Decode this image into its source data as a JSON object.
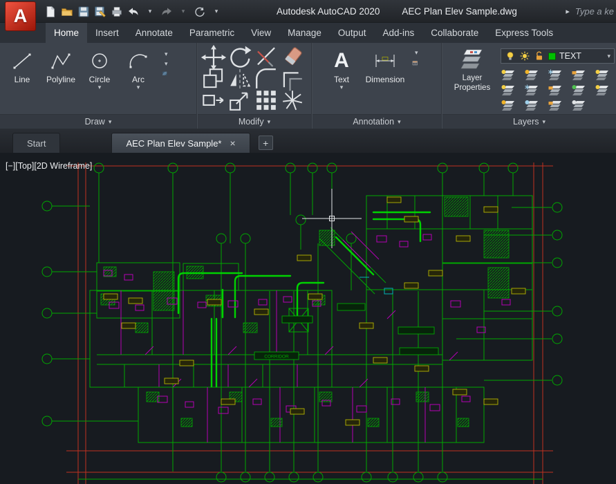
{
  "titlebar": {
    "logo_letter": "A",
    "app_title": "Autodesk AutoCAD 2020",
    "doc_title": "AEC Plan Elev Sample.dwg",
    "search_text": "Type a ke"
  },
  "icons": {
    "dropdown": "▾",
    "right_arrow": "▸",
    "plus": "+",
    "close": "×"
  },
  "ribbon_tabs": [
    {
      "label": "Home",
      "active": true
    },
    {
      "label": "Insert"
    },
    {
      "label": "Annotate"
    },
    {
      "label": "Parametric"
    },
    {
      "label": "View"
    },
    {
      "label": "Manage"
    },
    {
      "label": "Output"
    },
    {
      "label": "Add-ins"
    },
    {
      "label": "Collaborate"
    },
    {
      "label": "Express Tools"
    }
  ],
  "panels": {
    "draw": {
      "label": "Draw",
      "tools": [
        {
          "label": "Line"
        },
        {
          "label": "Polyline"
        },
        {
          "label": "Circle"
        },
        {
          "label": "Arc"
        }
      ]
    },
    "modify": {
      "label": "Modify"
    },
    "annotation": {
      "label": "Annotation",
      "text_tool": "Text",
      "dimension_tool": "Dimension"
    },
    "layers": {
      "label": "Layers",
      "lp_line1": "Layer",
      "lp_line2": "Properties",
      "current_layer": "TEXT"
    }
  },
  "file_tabs": {
    "start": "Start",
    "doc": "AEC Plan Elev Sample*"
  },
  "viewport": {
    "minimize": "[−]",
    "view": "[Top]",
    "style": "[2D Wireframe]"
  },
  "canvas_labels": {
    "corridor": "CORRIDOR"
  },
  "colors": {
    "grid_red": "#c03020",
    "draw_green": "#00a800",
    "bright_green": "#00d200",
    "magenta": "#b400b4",
    "yellow": "#b4b400",
    "canvas_bg": "#171b20"
  }
}
